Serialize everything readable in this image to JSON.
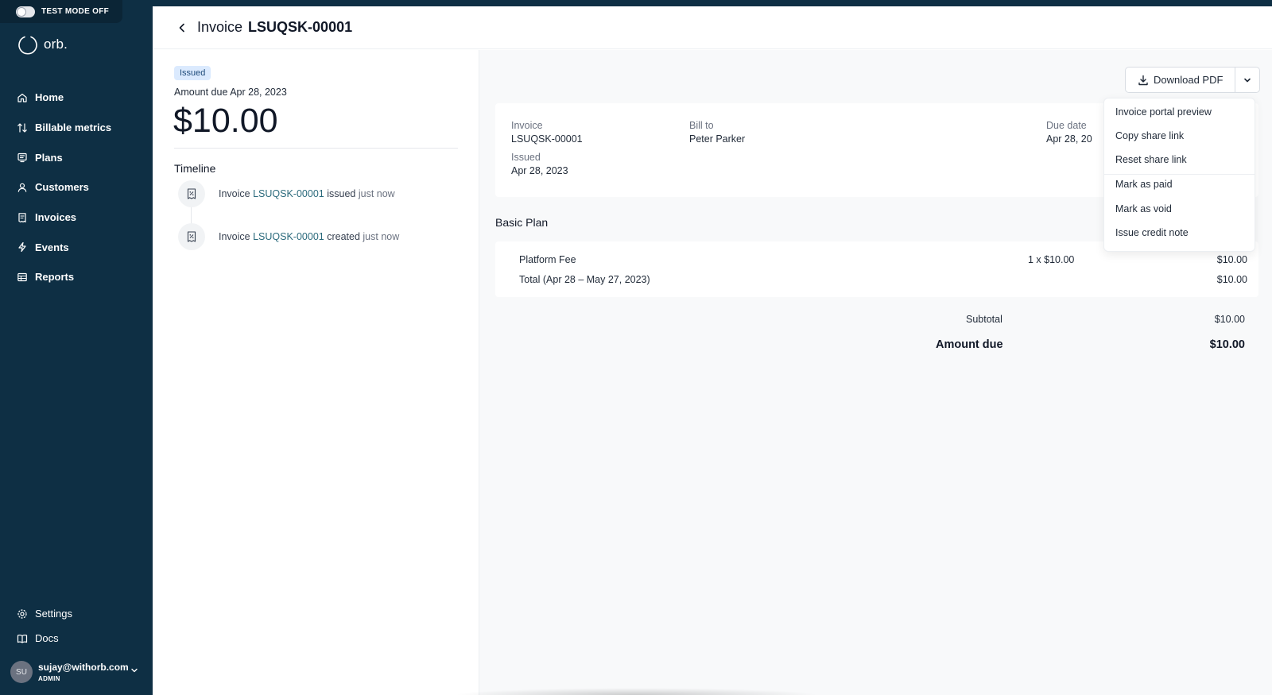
{
  "test_mode": {
    "label": "TEST MODE OFF"
  },
  "brand": {
    "name": "orb."
  },
  "sidebar": {
    "items": [
      {
        "label": "Home",
        "icon": "home-icon"
      },
      {
        "label": "Billable metrics",
        "icon": "arrows-up-down-icon"
      },
      {
        "label": "Plans",
        "icon": "plans-icon"
      },
      {
        "label": "Customers",
        "icon": "users-icon"
      },
      {
        "label": "Invoices",
        "icon": "receipt-icon"
      },
      {
        "label": "Events",
        "icon": "lightning-icon"
      },
      {
        "label": "Reports",
        "icon": "table-icon"
      }
    ],
    "bottom_items": [
      {
        "label": "Settings",
        "icon": "gear-icon"
      },
      {
        "label": "Docs",
        "icon": "book-icon"
      }
    ],
    "user": {
      "initials": "SU",
      "email": "sujay@withorb.com",
      "role": "ADMIN"
    }
  },
  "header": {
    "title_prefix": "Invoice",
    "invoice_id": "LSUQSK-00001"
  },
  "summary": {
    "status": "Issued",
    "amount_due_label": "Amount due Apr 28, 2023",
    "amount": "$10.00"
  },
  "timeline": {
    "title": "Timeline",
    "events": [
      {
        "prefix": "Invoice",
        "link": "LSUQSK-00001",
        "action": "issued",
        "time": "just now"
      },
      {
        "prefix": "Invoice",
        "link": "LSUQSK-00001",
        "action": "created",
        "time": "just now"
      }
    ]
  },
  "actions": {
    "download_label": "Download PDF",
    "menu": [
      "Invoice portal preview",
      "Copy share link",
      "Reset share link",
      "Mark as paid",
      "Mark as void",
      "Issue credit note"
    ]
  },
  "invoice": {
    "invoice_label": "Invoice",
    "invoice_number": "LSUQSK-00001",
    "issued_label": "Issued",
    "issued_date": "Apr 28, 2023",
    "bill_to_label": "Bill to",
    "bill_to": "Peter Parker",
    "due_date_label": "Due date",
    "due_date_partial": "Apr 28, 20"
  },
  "plan": {
    "name": "Basic Plan",
    "line_items": [
      {
        "name": "Platform Fee",
        "qty": "1 x $10.00",
        "amount": "$10.00"
      }
    ],
    "total_label": "Total (Apr 28 – May 27, 2023)",
    "total_amount": "$10.00"
  },
  "totals": {
    "subtotal_label": "Subtotal",
    "subtotal": "$10.00",
    "amount_due_label": "Amount due",
    "amount_due": "$10.00"
  },
  "colors": {
    "sidebar": "#0e2f44",
    "link": "#2b6a7c",
    "badge_bg": "#dbeafe"
  }
}
